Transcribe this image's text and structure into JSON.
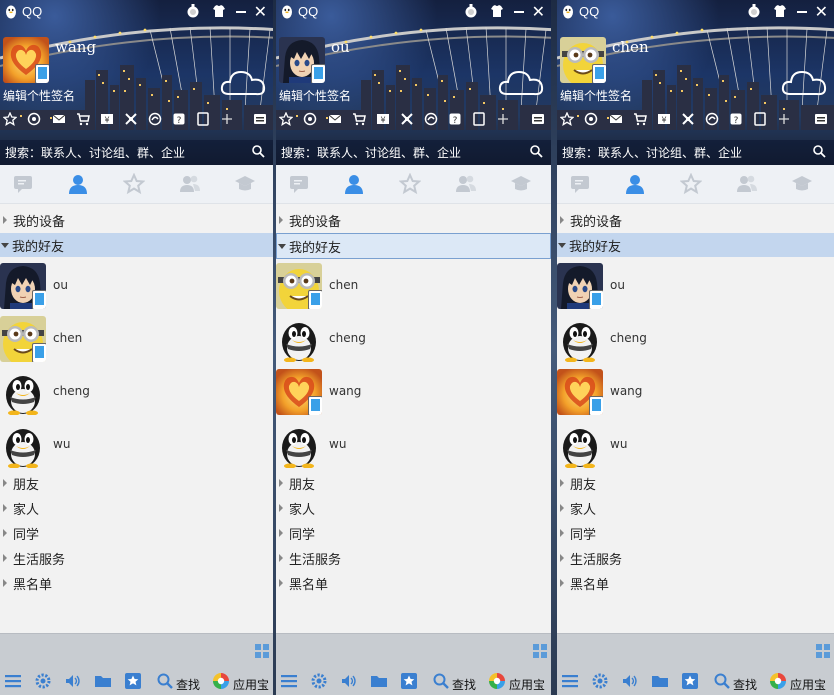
{
  "app": {
    "title": "QQ"
  },
  "panels": [
    {
      "username": "wang",
      "signature": "编辑个性签名",
      "search_placeholder": "搜索：联系人、讨论组、群、企业",
      "avatar_kind": "heart",
      "groups_top": [
        {
          "label": "我的设备",
          "open": false
        },
        {
          "label": "我的好友",
          "open": true
        }
      ],
      "friends": [
        {
          "name": "ou",
          "avatar": "anime",
          "mobile": true
        },
        {
          "name": "chen",
          "avatar": "minion",
          "mobile": true
        },
        {
          "name": "cheng",
          "avatar": "penguin",
          "mobile": false
        },
        {
          "name": "wu",
          "avatar": "penguin",
          "mobile": false
        }
      ],
      "groups_bottom": [
        {
          "label": "朋友"
        },
        {
          "label": "家人"
        },
        {
          "label": "同学"
        },
        {
          "label": "生活服务"
        },
        {
          "label": "黑名单"
        }
      ],
      "find_label": "查找",
      "app_store_label": "应用宝"
    },
    {
      "username": "ou",
      "signature": "编辑个性签名",
      "search_placeholder": "搜索：联系人、讨论组、群、企业",
      "avatar_kind": "anime",
      "groups_top": [
        {
          "label": "我的设备",
          "open": false
        },
        {
          "label": "我的好友",
          "open": true
        }
      ],
      "friends": [
        {
          "name": "chen",
          "avatar": "minion",
          "mobile": true
        },
        {
          "name": "cheng",
          "avatar": "penguin",
          "mobile": false
        },
        {
          "name": "wang",
          "avatar": "heart",
          "mobile": true
        },
        {
          "name": "wu",
          "avatar": "penguin",
          "mobile": false
        }
      ],
      "groups_bottom": [
        {
          "label": "朋友"
        },
        {
          "label": "家人"
        },
        {
          "label": "同学"
        },
        {
          "label": "生活服务"
        },
        {
          "label": "黑名单"
        }
      ],
      "find_label": "查找",
      "app_store_label": "应用宝"
    },
    {
      "username": "chen",
      "signature": "编辑个性签名",
      "search_placeholder": "搜索：联系人、讨论组、群、企业",
      "avatar_kind": "minion",
      "groups_top": [
        {
          "label": "我的设备",
          "open": false
        },
        {
          "label": "我的好友",
          "open": true
        }
      ],
      "friends": [
        {
          "name": "ou",
          "avatar": "anime",
          "mobile": true
        },
        {
          "name": "cheng",
          "avatar": "penguin",
          "mobile": false
        },
        {
          "name": "wang",
          "avatar": "heart",
          "mobile": true
        },
        {
          "name": "wu",
          "avatar": "penguin",
          "mobile": false
        }
      ],
      "groups_bottom": [
        {
          "label": "朋友"
        },
        {
          "label": "家人"
        },
        {
          "label": "同学"
        },
        {
          "label": "生活服务"
        },
        {
          "label": "黑名单"
        }
      ],
      "find_label": "查找",
      "app_store_label": "应用宝"
    }
  ],
  "colors": {
    "selected_group": "#c3d6ee",
    "header_dark": "#14203f",
    "bottom_bar": "#c8ccd1",
    "accent_blue": "#3aa0e8"
  }
}
